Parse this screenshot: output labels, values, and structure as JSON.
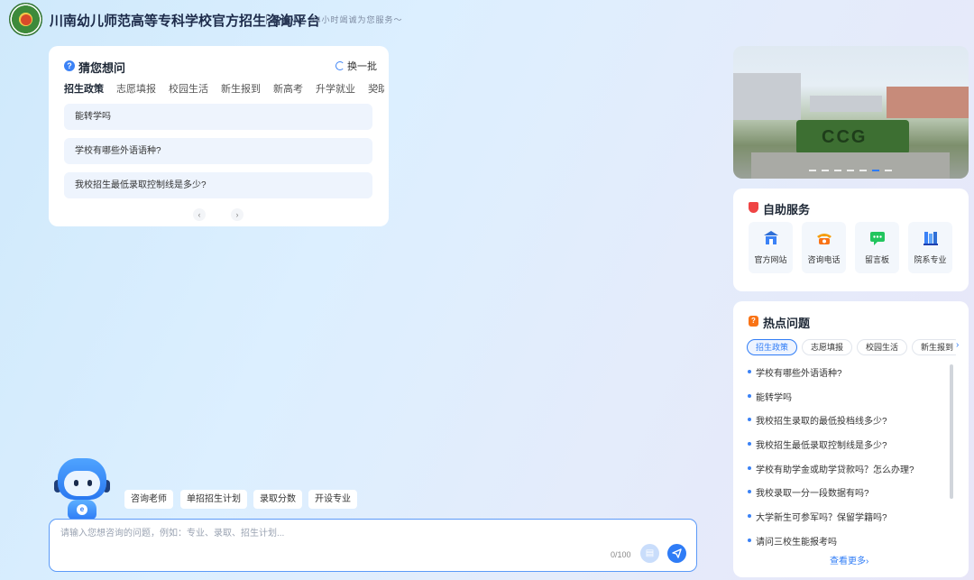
{
  "header": {
    "title": "川南幼儿师范高等专科学校官方招生咨询平台",
    "brand": "智能小E",
    "slogan": "· 24小时竭诚为您服务～"
  },
  "guess": {
    "title": "猜您想问",
    "refresh_label": "换一批",
    "tabs": [
      "招生政策",
      "志愿填报",
      "校园生活",
      "新生报到",
      "新高考",
      "升学就业",
      "奖助"
    ],
    "active_tab": 0,
    "questions": [
      "能转学吗",
      "学校有哪些外语语种?",
      "我校招生最低录取控制线是多少?"
    ]
  },
  "banner": {
    "caption": "CCG",
    "dot_count": 7,
    "active_dot": 5
  },
  "self_service": {
    "title": "自助服务",
    "items": [
      {
        "label": "官方网站",
        "icon": "school-building-icon"
      },
      {
        "label": "咨询电话",
        "icon": "phone-icon"
      },
      {
        "label": "留言板",
        "icon": "message-board-icon"
      },
      {
        "label": "院系专业",
        "icon": "books-icon"
      }
    ]
  },
  "hot": {
    "title": "热点问题",
    "chips": [
      "招生政策",
      "志愿填报",
      "校园生活",
      "新生报到"
    ],
    "active_chip": 0,
    "items": [
      "学校有哪些外语语种?",
      "能转学吗",
      "我校招生录取的最低投档线多少?",
      "我校招生最低录取控制线是多少?",
      "学校有助学金或助学贷款吗？怎么办理?",
      "我校录取一分一段数据有吗?",
      "大学新生可参军吗？保留学籍吗?",
      "请问三校生能报考吗"
    ],
    "more_label": "查看更多›"
  },
  "quick_actions": [
    "咨询老师",
    "单招招生计划",
    "录取分数",
    "开设专业"
  ],
  "chat": {
    "placeholder": "请输入您想咨询的问题，例如：专业、录取、招生计划...",
    "counter": "0/100"
  },
  "colors": {
    "accent": "#2f7cf6",
    "shield": "#ef4444",
    "hot": "#f97316"
  }
}
